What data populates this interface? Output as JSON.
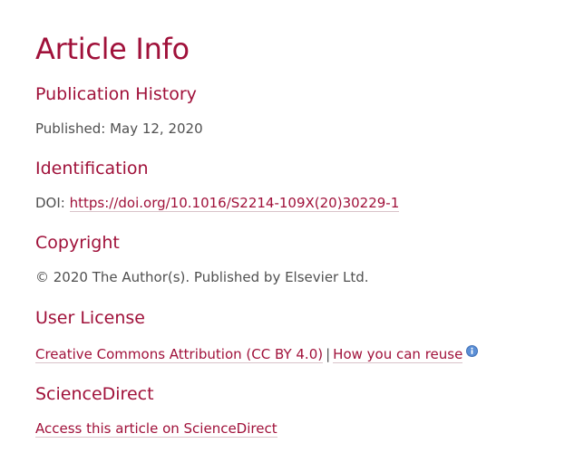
{
  "title": "Article Info",
  "publication_history": {
    "heading": "Publication History",
    "published_label": "Published:",
    "published_date": "May 12, 2020"
  },
  "identification": {
    "heading": "Identification",
    "doi_label": "DOI:",
    "doi_link": "https://doi.org/10.1016/S2214-109X(20)30229-1"
  },
  "copyright": {
    "heading": "Copyright",
    "text": "© 2020 The Author(s). Published by Elsevier Ltd."
  },
  "user_license": {
    "heading": "User License",
    "license_link": "Creative Commons Attribution (CC BY 4.0)",
    "separator": "|",
    "reuse_link": "How you can reuse",
    "info_icon": "info-icon"
  },
  "sciencedirect": {
    "heading": "ScienceDirect",
    "link": "Access this article on ScienceDirect"
  },
  "colors": {
    "accent": "#a0113a",
    "text": "#505050",
    "info_icon": "#5b8fd6"
  }
}
